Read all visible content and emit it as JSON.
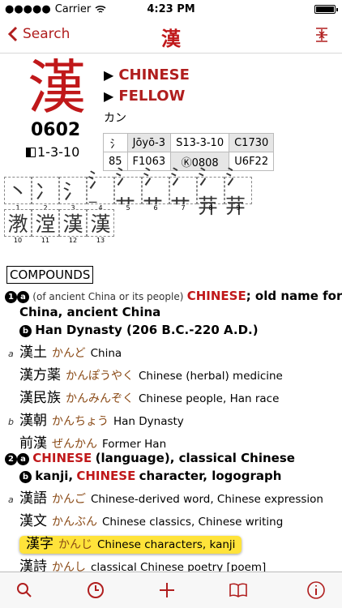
{
  "status": {
    "carrier": "Carrier",
    "time": "4:23 PM"
  },
  "nav": {
    "back_label": "Search",
    "title": "漢"
  },
  "kanji": {
    "char": "漢",
    "code": "0602",
    "position": "1-3-10",
    "meanings": [
      "CHINESE",
      "FELLOW"
    ],
    "reading": "カン"
  },
  "codes": {
    "radical": "氵",
    "radical_num": "85",
    "joyo": "Jōyō-3",
    "s": "S13-3-10",
    "c": "C1730",
    "f": "F1063",
    "k": "Ⓚ0808",
    "u": "U6F22"
  },
  "strokes": {
    "row1": [
      "丶",
      "冫",
      "氵",
      "氵⁻",
      "氵艹",
      "氵艹",
      "氵艹",
      "氵茾",
      "氵茾"
    ],
    "row1_nums": [
      "1",
      "2",
      "3",
      "4",
      "5",
      "6",
      "7",
      "8",
      "9"
    ],
    "row2": [
      "漖",
      "漟",
      "漢",
      "漢"
    ],
    "row2_nums": [
      "10",
      "11",
      "12",
      "13"
    ]
  },
  "compounds": {
    "heading": "COMPOUNDS",
    "sense1_a_pre": "(of ancient China or its people)",
    "sense1_a_red": "CHINESE",
    "sense1_a_post": "; old name for",
    "sense1_a_cont": "China, ancient China",
    "sense1_b": "Han Dynasty (206 B.C.-220 A.D.)",
    "entries1": [
      {
        "marker": "a",
        "word": "漢土",
        "kana": "かんど",
        "gloss": "China"
      },
      {
        "marker": "",
        "word": "漢方薬",
        "kana": "かんぽうやく",
        "gloss": "Chinese (herbal) medicine"
      },
      {
        "marker": "",
        "word": "漢民族",
        "kana": "かんみんぞく",
        "gloss": "Chinese people, Han race"
      },
      {
        "marker": "b",
        "word": "漢朝",
        "kana": "かんちょう",
        "gloss": "Han Dynasty"
      },
      {
        "marker": "",
        "word": "前漢",
        "kana": "ぜんかん",
        "gloss": "Former Han"
      }
    ],
    "sense2_a_red": "CHINESE",
    "sense2_a_post": "(language), classical Chinese",
    "sense2_b_pre": "kanji,",
    "sense2_b_red": "CHINESE",
    "sense2_b_post": "character, logograph",
    "entries2": [
      {
        "marker": "a",
        "word": "漢語",
        "kana": "かんご",
        "gloss": "Chinese-derived word, Chinese expression"
      },
      {
        "marker": "",
        "word": "漢文",
        "kana": "かんぶん",
        "gloss": "Chinese classics, Chinese writing"
      },
      {
        "marker": "",
        "word": "漢字",
        "kana": "かんじ",
        "gloss": "Chinese characters, kanji"
      },
      {
        "marker": "",
        "word": "漢詩",
        "kana": "かんし",
        "gloss": "classical Chinese poetry [poem]"
      }
    ]
  },
  "colors": {
    "accent": "#c0181a",
    "highlight": "#ffe33a"
  },
  "tabs": [
    "search-icon",
    "history-icon",
    "add-icon",
    "book-icon",
    "info-icon"
  ]
}
